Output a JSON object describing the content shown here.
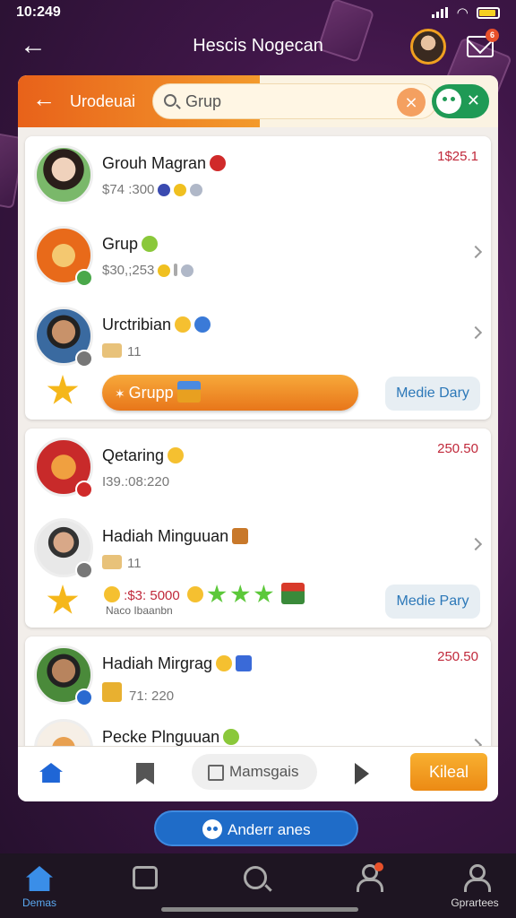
{
  "status_bar": {
    "time": "10:249"
  },
  "header": {
    "title": "Hescis Nogecan",
    "mail_badge": "6"
  },
  "panel": {
    "back_label": "Urodeuai",
    "search": {
      "value": "Grup"
    },
    "clear_symbol": "⨯",
    "toggle_symbol": "✕"
  },
  "group1": {
    "rows": [
      {
        "title": "Grouh Magran",
        "subtitle": "$74 :300",
        "amount": "1$25.1"
      },
      {
        "title": "Grup",
        "subtitle": "$30,;253"
      },
      {
        "title": "Urctribian",
        "subtitle": "11"
      }
    ],
    "action_button": "Grupp",
    "side_button": "Medie Dary"
  },
  "group2": {
    "rows": [
      {
        "title": "Qetaring",
        "subtitle": "I39.:08:220",
        "amount": "250.50"
      },
      {
        "title": "Hadiah Minguuan",
        "subtitle": "11"
      }
    ],
    "reward_amount": ":$3: 5000",
    "reward_caption": "Naco Ibaanbn",
    "side_button": "Medie Pary"
  },
  "group3": {
    "rows": [
      {
        "title": "Hadiah Mirgrag",
        "subtitle": "71: 220",
        "amount": "250.50"
      },
      {
        "title": "Pecke Plnguuan"
      }
    ]
  },
  "toolbar": {
    "pill_label": "Mamsgais",
    "action_label": "Kileal"
  },
  "float_button": {
    "label": "Anderr anes"
  },
  "bottom_nav": {
    "items": [
      {
        "label": "Demas"
      },
      {
        "label": ""
      },
      {
        "label": ""
      },
      {
        "label": ""
      },
      {
        "label": "Gprartees"
      }
    ]
  },
  "colors": {
    "accent_orange": "#e8762a",
    "accent_blue": "#1f6cc8",
    "accent_green": "#1f9a55",
    "amount_red": "#c0283a"
  }
}
